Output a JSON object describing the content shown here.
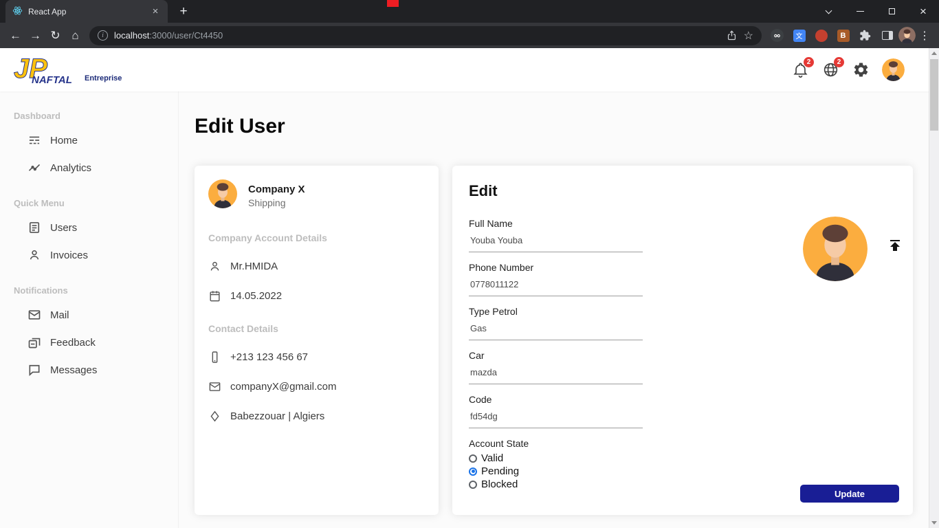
{
  "browser": {
    "tab_title": "React App",
    "url": {
      "host": "localhost",
      "path": ":3000/user/Ct4450"
    }
  },
  "icons": {
    "back": "←",
    "forward": "→",
    "reload": "↻",
    "home": "⌂",
    "star": "☆",
    "menu": "⋮",
    "plus": "+",
    "close_tab": "×",
    "info": "i",
    "translate_glyph": "文",
    "extension_b": "B"
  },
  "header": {
    "brand": {
      "glyph": "JP",
      "name": "NAFTAL",
      "suffix": "Entreprise"
    },
    "notifications_badge": "2",
    "language_badge": "2"
  },
  "sidebar": {
    "sections": [
      {
        "title": "Dashboard",
        "items": [
          {
            "label": "Home"
          },
          {
            "label": "Analytics"
          }
        ]
      },
      {
        "title": "Quick Menu",
        "items": [
          {
            "label": "Users"
          },
          {
            "label": "Invoices"
          }
        ]
      },
      {
        "title": "Notifications",
        "items": [
          {
            "label": "Mail"
          },
          {
            "label": "Feedback"
          },
          {
            "label": "Messages"
          }
        ]
      }
    ]
  },
  "main": {
    "page_title": "Edit User",
    "profile_card": {
      "name": "Company X",
      "subtitle": "Shipping",
      "account_section_title": "Company Account Details",
      "account_items": [
        {
          "text": "Mr.HMIDA"
        },
        {
          "text": "14.05.2022"
        }
      ],
      "contact_section_title": "Contact Details",
      "contact_items": [
        {
          "text": "+213 123 456 67"
        },
        {
          "text": "companyX@gmail.com"
        },
        {
          "text": "Babezzouar | Algiers"
        }
      ]
    },
    "edit_card": {
      "title": "Edit",
      "fields": [
        {
          "label": "Full Name",
          "value": "Youba Youba"
        },
        {
          "label": "Phone Number",
          "value": "0778011122"
        },
        {
          "label": "Type Petrol",
          "value": "Gas"
        },
        {
          "label": "Car",
          "value": "mazda"
        },
        {
          "label": "Code",
          "value": "fd54dg"
        }
      ],
      "account_state": {
        "label": "Account State",
        "options": [
          {
            "label": "Valid",
            "selected": false
          },
          {
            "label": "Pending",
            "selected": true
          },
          {
            "label": "Blocked",
            "selected": false
          }
        ]
      },
      "update_label": "Update"
    }
  },
  "colors": {
    "accent_navy": "#191e95",
    "avatar_orange": "#fbad3f",
    "badge_red": "#e53935",
    "radio_blue": "#1a73e8",
    "chrome_dark": "#202124",
    "chrome_toolbar": "#35363a"
  }
}
